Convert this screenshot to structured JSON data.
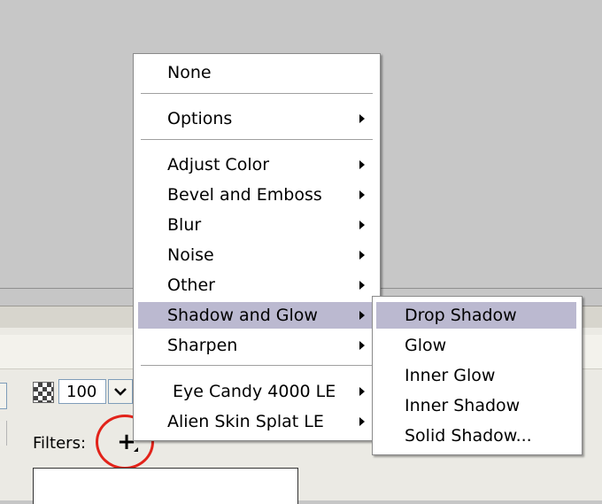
{
  "properties_panel": {
    "opacity_value": "100",
    "opacity_dropdown": "⌄",
    "filters_label": "Filters:",
    "add_filter_glyph": "+"
  },
  "filter_menu": {
    "items": [
      {
        "label": "None",
        "submenu": false
      },
      {
        "label": "Options",
        "submenu": true
      },
      {
        "label": "Adjust Color",
        "submenu": true
      },
      {
        "label": "Bevel and Emboss",
        "submenu": true
      },
      {
        "label": "Blur",
        "submenu": true
      },
      {
        "label": "Noise",
        "submenu": true
      },
      {
        "label": "Other",
        "submenu": true
      },
      {
        "label": "Shadow and Glow",
        "submenu": true,
        "highlighted": true
      },
      {
        "label": "Sharpen",
        "submenu": true
      },
      {
        "label": "Eye Candy 4000 LE",
        "submenu": true
      },
      {
        "label": "Alien Skin Splat LE",
        "submenu": true
      }
    ]
  },
  "shadow_glow_submenu": {
    "items": [
      {
        "label": "Drop Shadow",
        "highlighted": true
      },
      {
        "label": "Glow"
      },
      {
        "label": "Inner Glow"
      },
      {
        "label": "Inner Shadow"
      },
      {
        "label": "Solid Shadow..."
      }
    ]
  },
  "colors": {
    "highlight": "#bbb9d0",
    "annotation_circle": "#e2231a"
  }
}
